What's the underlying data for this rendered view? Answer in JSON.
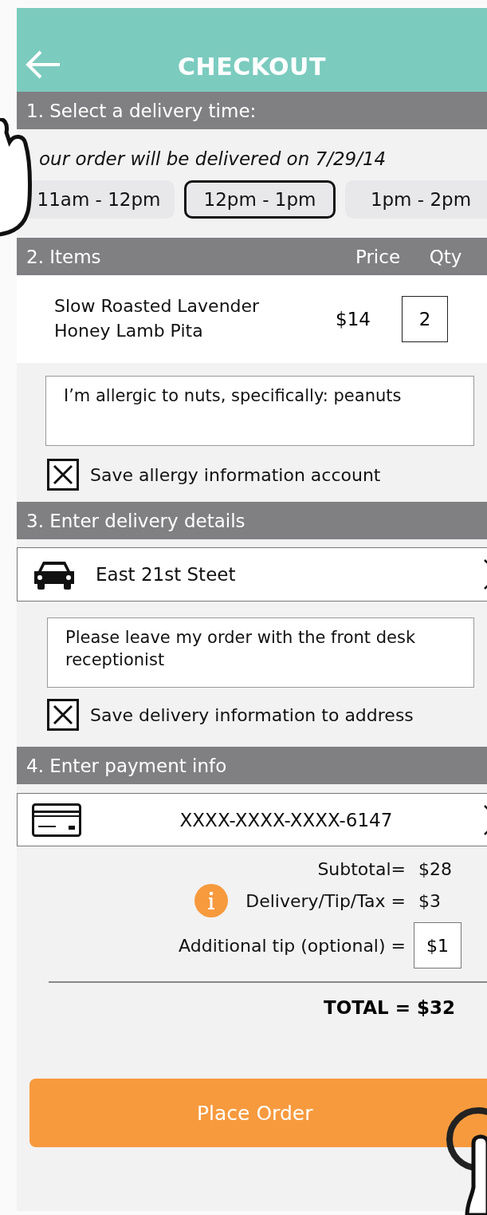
{
  "header": {
    "title": "CHECKOUT"
  },
  "time_section": {
    "heading": "1. Select a delivery time:",
    "date_note": "our order will be delivered on 7/29/14",
    "slots": [
      {
        "label": "11am - 12pm",
        "selected": false
      },
      {
        "label": "12pm - 1pm",
        "selected": true
      },
      {
        "label": "1pm - 2pm",
        "selected": false
      }
    ]
  },
  "items_section": {
    "heading": "2. Items",
    "columns": [
      "Price",
      "Qty"
    ],
    "items": [
      {
        "name": "Slow Roasted Lavender Honey Lamb Pita",
        "price": "$14",
        "qty": "2"
      }
    ],
    "allergy_note": "I’m allergic to nuts, specifically: peanuts",
    "save_allergy": {
      "label": "Save allergy information account",
      "checked": true
    }
  },
  "delivery_section": {
    "heading": "3. Enter delivery details",
    "address": "East 21st Steet",
    "note": "Please leave my order with the front desk receptionist",
    "save_delivery": {
      "label": "Save delivery information to address",
      "checked": true
    }
  },
  "payment_section": {
    "heading": "4. Enter payment info",
    "card": "XXXX-XXXX-XXXX-6147"
  },
  "totals": {
    "lines": [
      {
        "label": "Subtotal=",
        "value": "$28",
        "kind": "plain"
      },
      {
        "label": "Delivery/Tip/Tax =",
        "value": "$3",
        "kind": "info"
      },
      {
        "label": "Additional tip (optional) =",
        "value": "$1",
        "kind": "input"
      }
    ],
    "total": "TOTAL = $32"
  },
  "place_order": "Place Order"
}
